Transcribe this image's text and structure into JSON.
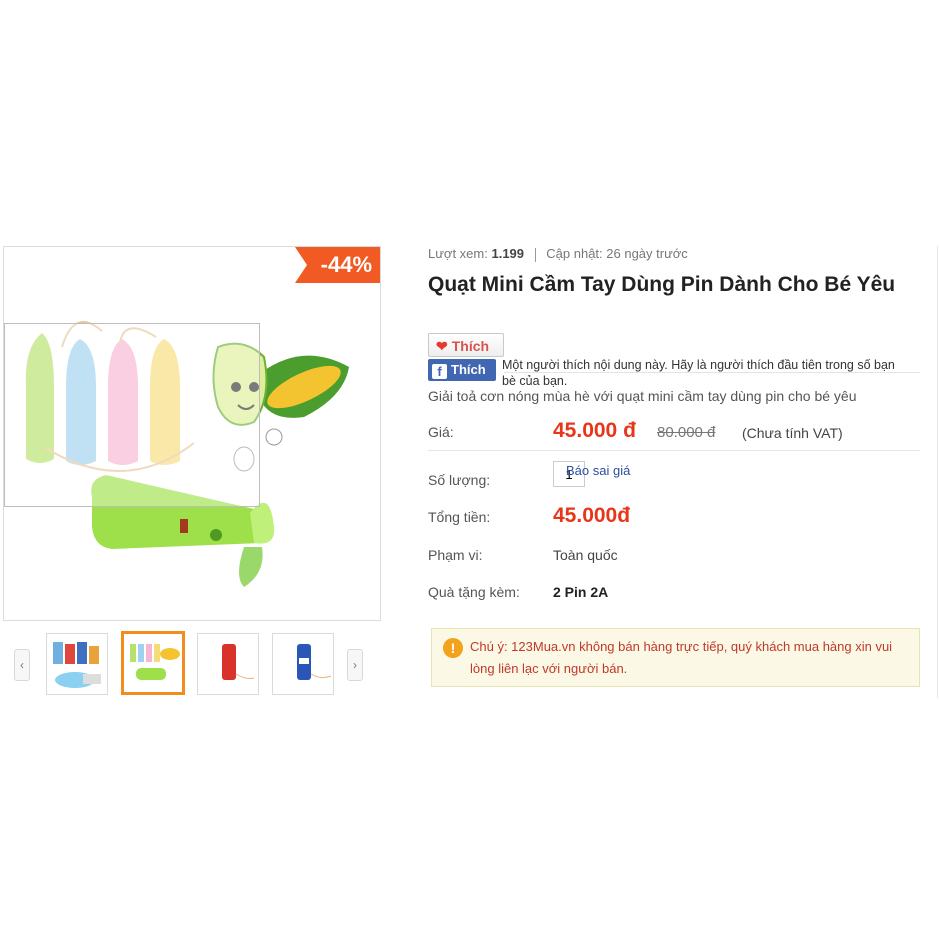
{
  "product": {
    "discount_badge": "-44%",
    "views_label": "Lượt xem:",
    "views_value": "1.199",
    "updated_label": "Cập nhật: 26 ngày trước",
    "title": "Quạt Mini Cầm Tay Dùng Pin Dành Cho Bé Yêu",
    "description": "Giải toả cơn nóng mùa hè với quạt mini cầm tay dùng pin cho bé yêu"
  },
  "social": {
    "like_button": "Thích",
    "fb_button": "Thích",
    "fb_text": "Một người thích nội dung này. Hãy là người thích đầu tiên trong số bạn bè của bạn."
  },
  "pricing": {
    "price_label": "Giá:",
    "price": "45.000 đ",
    "old_price": "80.000 đ",
    "vat_note": "(Chưa tính VAT)",
    "quantity_label": "Số lượng:",
    "quantity_value": "1",
    "report_link": "Báo sai giá",
    "total_label": "Tổng tiền:",
    "total": "45.000đ",
    "scope_label": "Phạm vi:",
    "scope_value": "Toàn quốc",
    "gift_label": "Quà tặng kèm:",
    "gift_value": "2 Pin 2A"
  },
  "notice": {
    "text": "Chú ý: 123Mua.vn không bán hàng trực tiếp, quý khách mua hàng xin vui lòng liên lạc với người bán."
  },
  "gallery": {
    "prev_icon": "‹",
    "next_icon": "›",
    "active_thumb_index": 1
  },
  "colors": {
    "accent_orange": "#f15a22",
    "price_red": "#e8361b",
    "facebook_blue": "#4267b2",
    "notice_bg": "#fbf8e6"
  }
}
